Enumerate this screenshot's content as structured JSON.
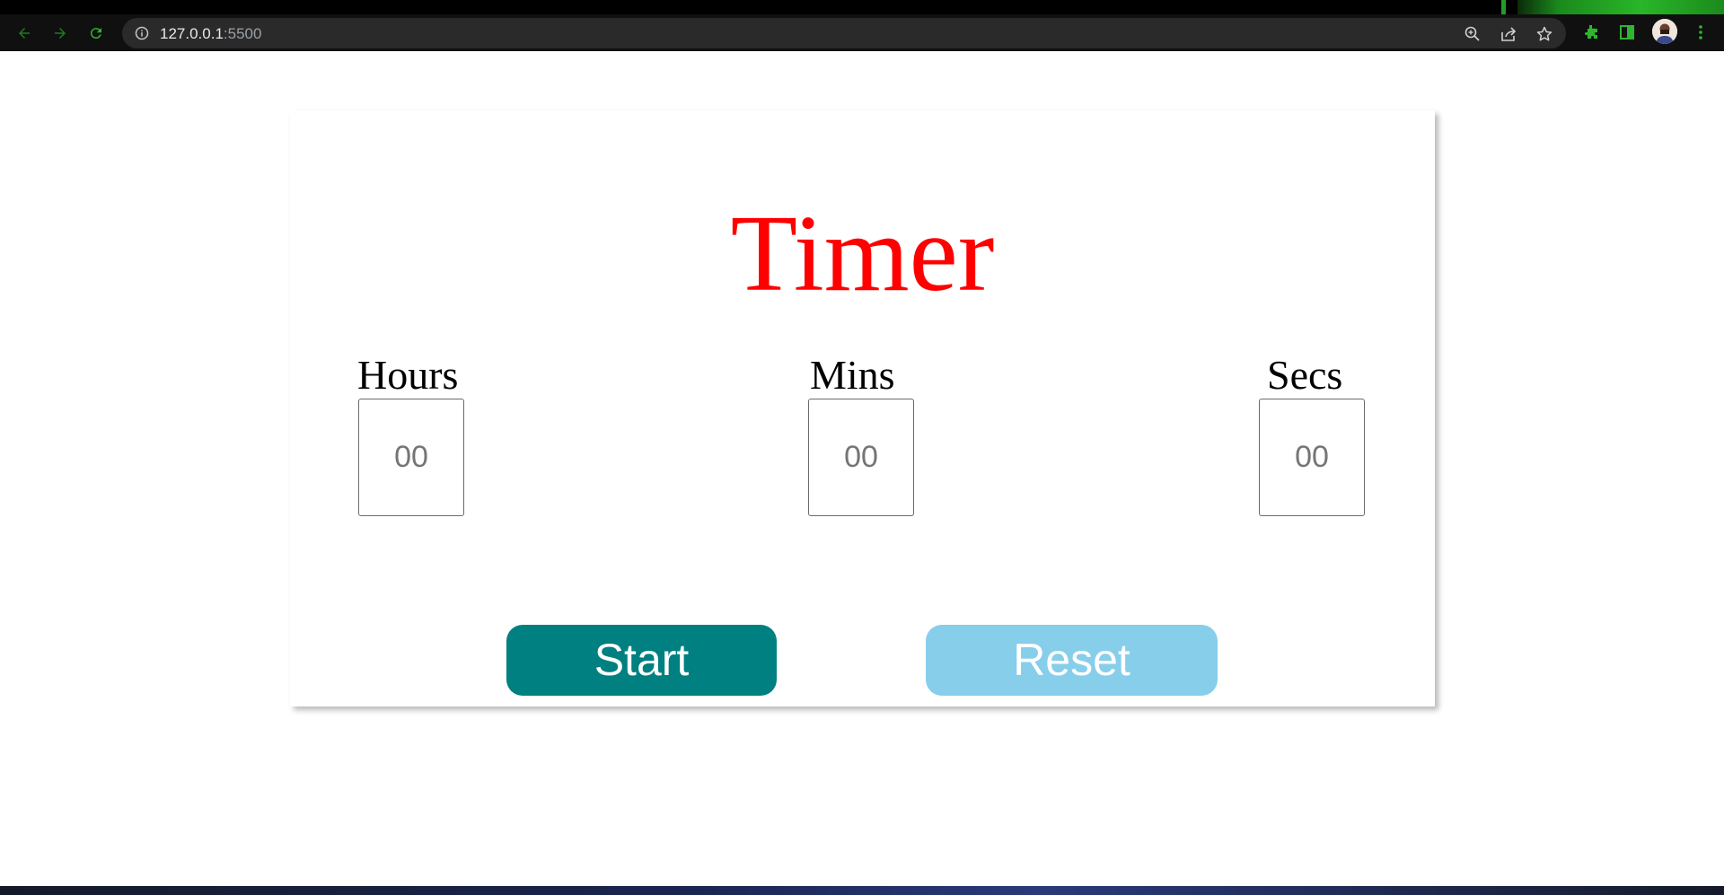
{
  "browser": {
    "url_host": "127.0.0.1",
    "url_port": ":5500"
  },
  "timer": {
    "title": "Timer",
    "fields": [
      {
        "label": "Hours",
        "placeholder": "00"
      },
      {
        "label": "Mins",
        "placeholder": "00"
      },
      {
        "label": "Secs",
        "placeholder": "00"
      }
    ],
    "start_label": "Start",
    "reset_label": "Reset"
  },
  "colors": {
    "title": "#ff0000",
    "start_button": "#008080",
    "reset_button": "#87ceeb"
  },
  "icons": [
    "back-icon",
    "forward-icon",
    "reload-icon",
    "info-icon",
    "zoom-icon",
    "share-icon",
    "star-icon",
    "extensions-icon",
    "side-panel-icon",
    "avatar",
    "menu-icon"
  ]
}
